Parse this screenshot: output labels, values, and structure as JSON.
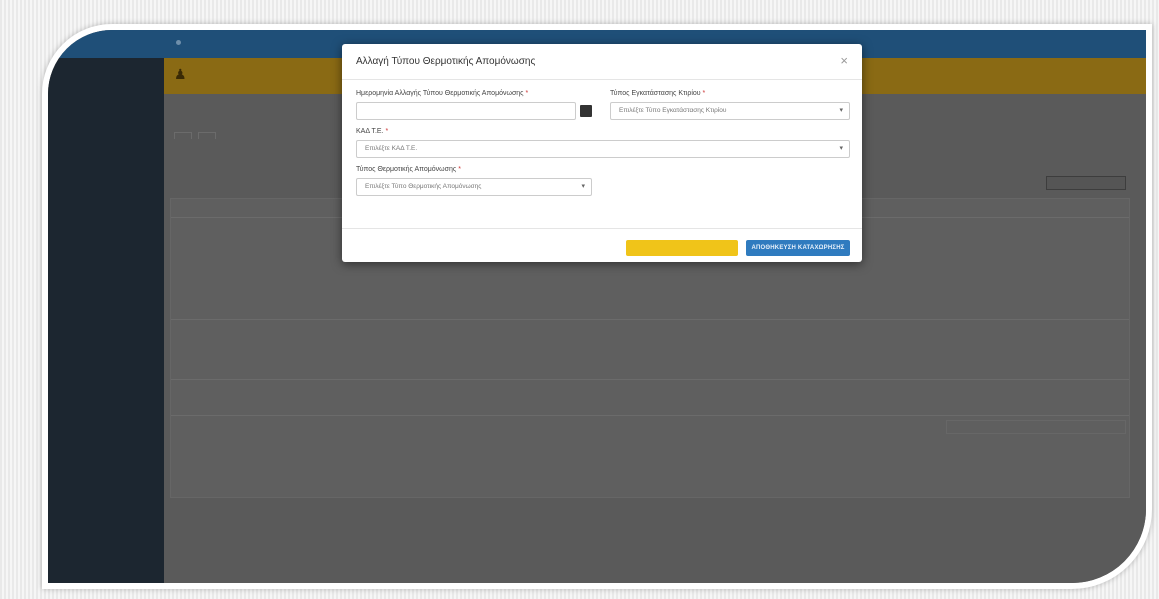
{
  "topnav": {
    "user": ""
  },
  "sidebar": {
    "items": [],
    "footer": ""
  },
  "main": {
    "page_title": "",
    "tabs": [],
    "top_right_button": "",
    "ghost_button": ""
  },
  "modal": {
    "title": "Αλλαγή Τύπου Θερμοτικής Απομόνωσης",
    "close_symbol": "×",
    "fields": {
      "description_label": "Ημερομηνία Αλλαγής Τύπου Θερμοτικής Απομόνωσης",
      "description_placeholder": "",
      "installation_type_label": "Τύπος Εγκατάστασης Κτιρίου",
      "installation_type_value": "Επιλέξτε Τύπο Εγκατάστασης Κτιρίου",
      "kad_label": "ΚΑΔ Τ.Ε.",
      "kad_value": "Επιλέξτε ΚΑΔ Τ.Ε.",
      "isolation_type_label": "Τύπος Θερμοτικής Απομόνωσης",
      "isolation_type_value": "Επιλέξτε Τύπο Θερμοτικής Απομόνωσης"
    },
    "required_mark": "*",
    "buttons": {
      "cancel": "",
      "save": "ΑΠΟΘΗΚΕΥΣΗ ΚΑΤΑΧΩΡΗΣΗΣ"
    }
  },
  "colors": {
    "topnav": "#1f4f78",
    "sidebar": "#1c2630",
    "banner": "#8a6a14",
    "warning_button": "#f0c419",
    "primary_button": "#2f7bbf"
  }
}
